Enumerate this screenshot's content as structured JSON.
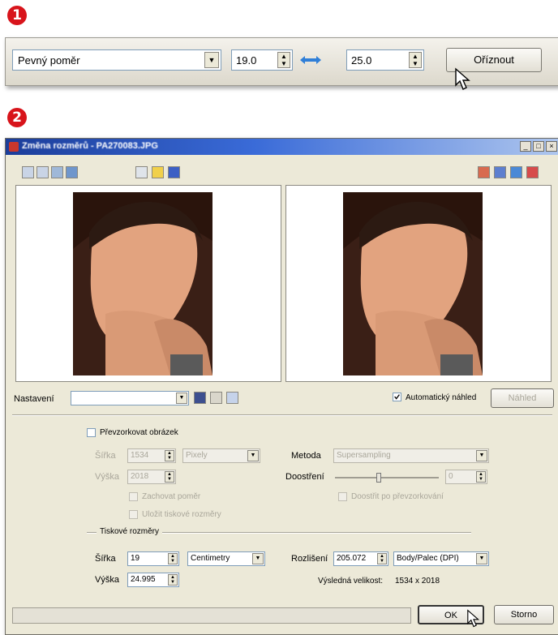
{
  "step_badges": [
    "1",
    "2"
  ],
  "crop_toolbar": {
    "aspect_mode": "Pevný poměr",
    "width_value": "19.0",
    "height_value": "25.0",
    "crop_button": "Oříznout"
  },
  "dialog": {
    "title": "Změna rozměrů - PA270083.JPG",
    "window_buttons": [
      "_",
      "□",
      "×"
    ],
    "settings_label": "Nastavení",
    "settings_value": "",
    "auto_preview_label": "Automatický náhled",
    "preview_button": "Náhled",
    "resample_label": "Převzorkovat obrázek",
    "resample_width_label": "Šířka",
    "resample_width_value": "1534",
    "resample_height_label": "Výška",
    "resample_height_value": "2018",
    "resample_unit": "Pixely",
    "method_label": "Metoda",
    "method_value": "Supersampling",
    "sharpen_label": "Doostření",
    "sharpen_value": "0",
    "sharpen_level": 0.42,
    "keep_ratio_label": "Zachovat poměr",
    "keep_print_label": "Uložit tiskové rozměry",
    "sharpen_after_label": "Doostřit po převzorkování",
    "print_size_legend": "Tiskové rozměry",
    "print_width_label": "Šířka",
    "print_width_value": "19",
    "print_height_label": "Výška",
    "print_height_value": "24.995",
    "print_unit": "Centimetry",
    "resolution_label": "Rozlišení",
    "resolution_value": "205.072",
    "resolution_unit": "Body/Palec (DPI)",
    "result_size_label": "Výsledná velikost:",
    "result_size_value": "1534 x 2018",
    "ok_button": "OK",
    "cancel_button": "Storno"
  },
  "colors": {
    "badge": "#d8141b",
    "titlebar": "#1b3d9a",
    "dialog_bg": "#ece9d8",
    "swap_arrow": "#2f7fd8"
  }
}
